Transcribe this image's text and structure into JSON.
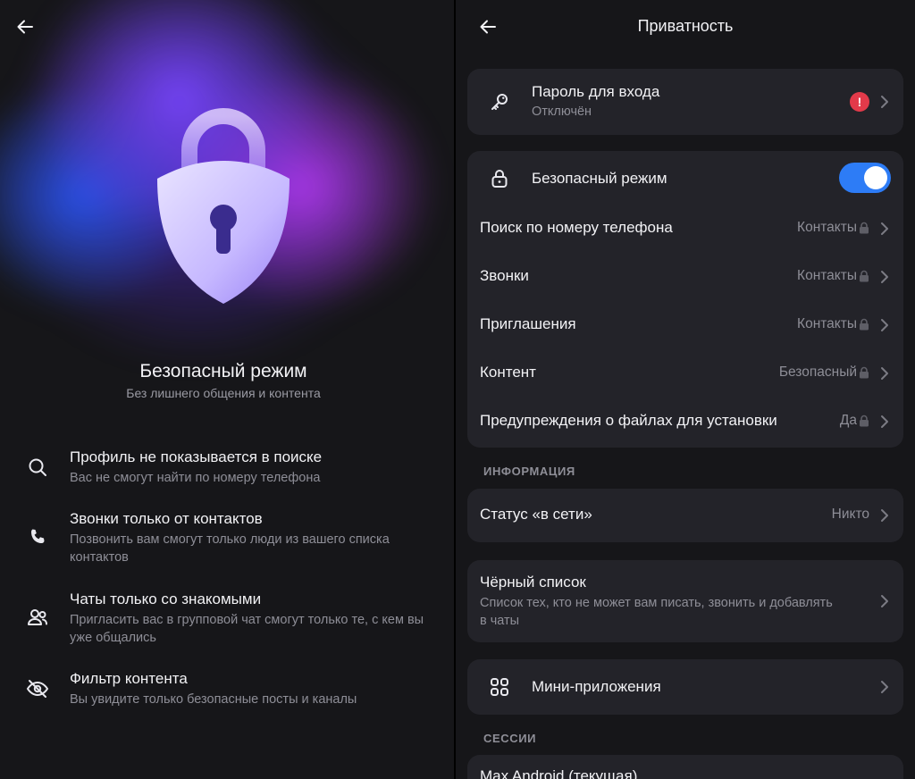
{
  "left": {
    "back_icon": "arrow-left-icon",
    "hero_icon": "padlock-shield-icon",
    "title": "Безопасный режим",
    "subtitle": "Без лишнего общения и контента",
    "features": [
      {
        "icon": "search-icon",
        "title": "Профиль не показывается в поиске",
        "desc": "Вас не смогут найти по номеру телефона"
      },
      {
        "icon": "phone-icon",
        "title": "Звонки только от контактов",
        "desc": "Позвонить вам смогут только люди из вашего списка контактов"
      },
      {
        "icon": "people-icon",
        "title": "Чаты только со знакомыми",
        "desc": "Пригласить вас в групповой чат смогут только те, с кем вы уже общались"
      },
      {
        "icon": "eye-off-icon",
        "title": "Фильтр контента",
        "desc": "Вы увидите только безопасные посты и каналы"
      }
    ]
  },
  "right": {
    "back_icon": "arrow-left-icon",
    "title": "Приватность",
    "password": {
      "label": "Пароль для входа",
      "status": "Отключён",
      "alert": "!"
    },
    "safe_mode": {
      "label": "Безопасный режим",
      "enabled": true
    },
    "settings": [
      {
        "label": "Поиск по номеру телефона",
        "value": "Контакты",
        "locked": true
      },
      {
        "label": "Звонки",
        "value": "Контакты",
        "locked": true
      },
      {
        "label": "Приглашения",
        "value": "Контакты",
        "locked": true
      },
      {
        "label": "Контент",
        "value": "Безопасный",
        "locked": true
      },
      {
        "label": "Предупреждения о файлах для установки",
        "value": "Да",
        "locked": true
      }
    ],
    "info_header": "ИНФОРМАЦИЯ",
    "online_status": {
      "label": "Статус «в сети»",
      "value": "Никто"
    },
    "blacklist": {
      "label": "Чёрный список",
      "desc": "Список тех, кто не может вам писать, звонить и добавлять в чаты"
    },
    "mini_apps": {
      "label": "Мини-приложения"
    },
    "sessions_header": "СЕССИИ",
    "session": {
      "label": "Max Android (текущая)"
    }
  },
  "colors": {
    "background": "#161619",
    "card": "#232329",
    "accent": "#2d7cf6",
    "alert": "#e23a4a",
    "muted_text": "#8e8e97"
  }
}
